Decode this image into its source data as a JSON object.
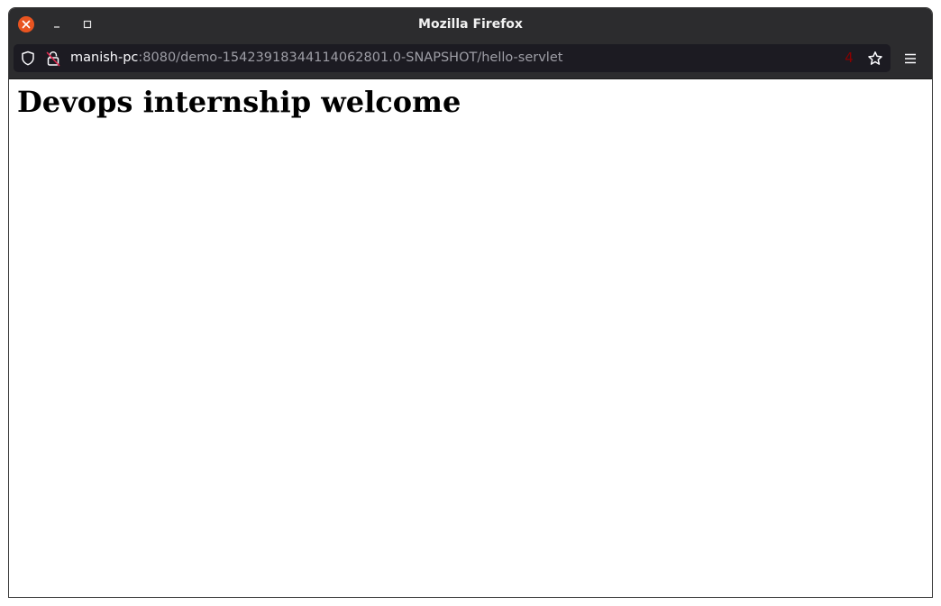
{
  "window": {
    "title": "Mozilla Firefox"
  },
  "toolbar": {
    "url_host": "manish-pc",
    "url_rest": ":8080/demo-15423918344114062801.0-SNAPSHOT/hello-servlet",
    "badge_count": "4",
    "icons": [
      "shield-icon",
      "insecure-lock-icon",
      "star-icon",
      "menu-icon"
    ]
  },
  "page": {
    "heading": "Devops internship welcome"
  },
  "colors": {
    "titlebar_bg": "#2c2c2e",
    "urlbar_bg": "#1c1b22",
    "close_button": "#e95420",
    "badge_text": "#8b0000",
    "page_bg": "#ffffff"
  }
}
